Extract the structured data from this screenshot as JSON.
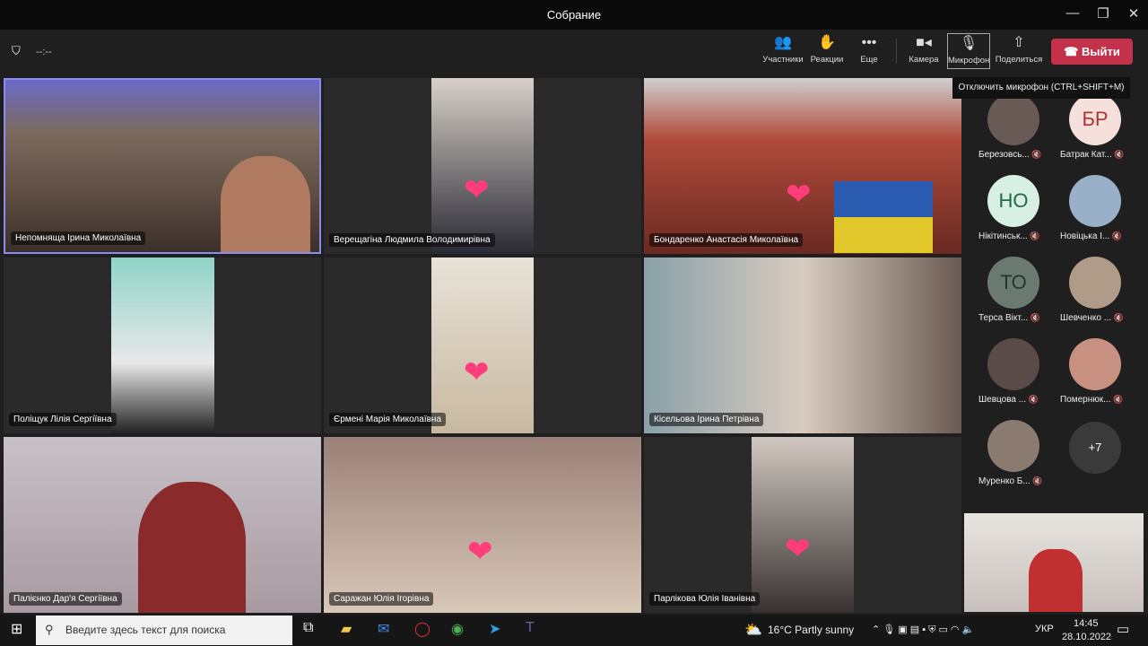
{
  "window": {
    "title": "Собрание",
    "minimize": "—",
    "maximize": "❐",
    "close": "✕"
  },
  "meeting": {
    "timer": "--:--"
  },
  "toolbar": {
    "participants": "Участники",
    "reactions": "Реакции",
    "more": "Еще",
    "camera": "Камера",
    "mic": "Микрофон",
    "share": "Поделиться",
    "leave": "Выйти",
    "mic_tooltip": "Отключить микрофон (CTRL+SHIFT+M)"
  },
  "tiles": [
    {
      "name": "Непомняща Ірина Миколаївна"
    },
    {
      "name": "Верещагіна Людмила Володимирівна"
    },
    {
      "name": "Бондаренко Анастасія Миколаївна"
    },
    {
      "name": "Поліщук Лілія Сергіївна"
    },
    {
      "name": "Єрмені Марія Миколаївна"
    },
    {
      "name": "Кісельова Ірина Петрівна"
    },
    {
      "name": "Палієнко Дар'я Сергіївна"
    },
    {
      "name": "Саражан Юлія Ігорівна"
    },
    {
      "name": "Парлікова Юлія Іванівна"
    }
  ],
  "sidebar": [
    {
      "name": "Березовсь...",
      "initials": ""
    },
    {
      "name": "Батрак Кат...",
      "initials": "БР"
    },
    {
      "name": "Нікітинськ...",
      "initials": "НО"
    },
    {
      "name": "Новіцька І...",
      "initials": ""
    },
    {
      "name": "Терса Вікт...",
      "initials": "ТО"
    },
    {
      "name": "Шевченко ...",
      "initials": ""
    },
    {
      "name": "Шевцова ...",
      "initials": ""
    },
    {
      "name": "Помернюк...",
      "initials": ""
    },
    {
      "name": "Муренко Б...",
      "initials": ""
    }
  ],
  "overflow": "+7",
  "taskbar": {
    "search_placeholder": "Введите здесь текст для поиска",
    "weather": "16°C  Partly sunny",
    "lang": "УКР",
    "time": "14:45",
    "date": "28.10.2022"
  }
}
